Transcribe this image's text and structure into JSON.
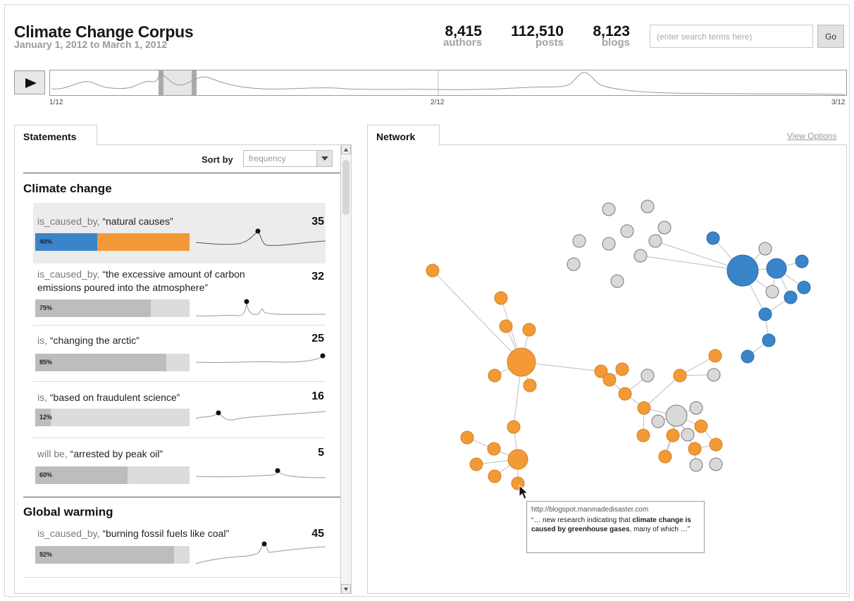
{
  "header": {
    "title": "Climate Change Corpus",
    "date_range": "January 1, 2012 to March 1, 2012",
    "stats": [
      {
        "value": "8,415",
        "label": "authors"
      },
      {
        "value": "112,510",
        "label": "posts"
      },
      {
        "value": "8,123",
        "label": "blogs"
      }
    ],
    "search_placeholder": "(enter search terms here)",
    "go_label": "Go"
  },
  "timeline": {
    "tick_labels": [
      "1/12",
      "2/12",
      "3/12"
    ],
    "play_icon": "play-icon"
  },
  "statements_panel": {
    "tab_label": "Statements",
    "sort_label": "Sort by",
    "sort_value": "frequency",
    "groups": [
      {
        "title": "Climate change",
        "items": [
          {
            "relation": "is_caused_by,",
            "object": " “natural causes”",
            "count": "35",
            "percent_label": "40%",
            "percent": 40,
            "selected": true
          },
          {
            "relation": "is_caused_by,",
            "object": " “the excessive amount of carbon emissions poured into the atmosphere”",
            "count": "32",
            "percent_label": "75%",
            "percent": 75,
            "selected": false
          },
          {
            "relation": "is,",
            "object": " “changing the arctic”",
            "count": "25",
            "percent_label": "85%",
            "percent": 85,
            "selected": false
          },
          {
            "relation": "is,",
            "object": " “based on fraudulent science”",
            "count": "16",
            "percent_label": "12%",
            "percent": 12,
            "selected": false
          },
          {
            "relation": "will be,",
            "object": " “arrested by peak oil”",
            "count": "5",
            "percent_label": "60%",
            "percent": 60,
            "selected": false
          }
        ]
      },
      {
        "title": "Global warming",
        "items": [
          {
            "relation": "is_caused_by,",
            "object": " “burning fossil fuels like coal”",
            "count": "45",
            "percent_label": "92%",
            "percent": 92,
            "selected": false
          }
        ]
      }
    ]
  },
  "network_panel": {
    "tab_label": "Network",
    "view_options": "View Options",
    "colors": {
      "orange": "#f39a37",
      "blue": "#3a85c9",
      "gray": "#d9d9d9"
    },
    "tooltip": {
      "url": "http://blogspot.manmadedisaster.com",
      "quote_before": "“… new research indicating that ",
      "quote_bold": "climate change is caused by greenhouse gases",
      "quote_after": ", many of which …”"
    }
  }
}
